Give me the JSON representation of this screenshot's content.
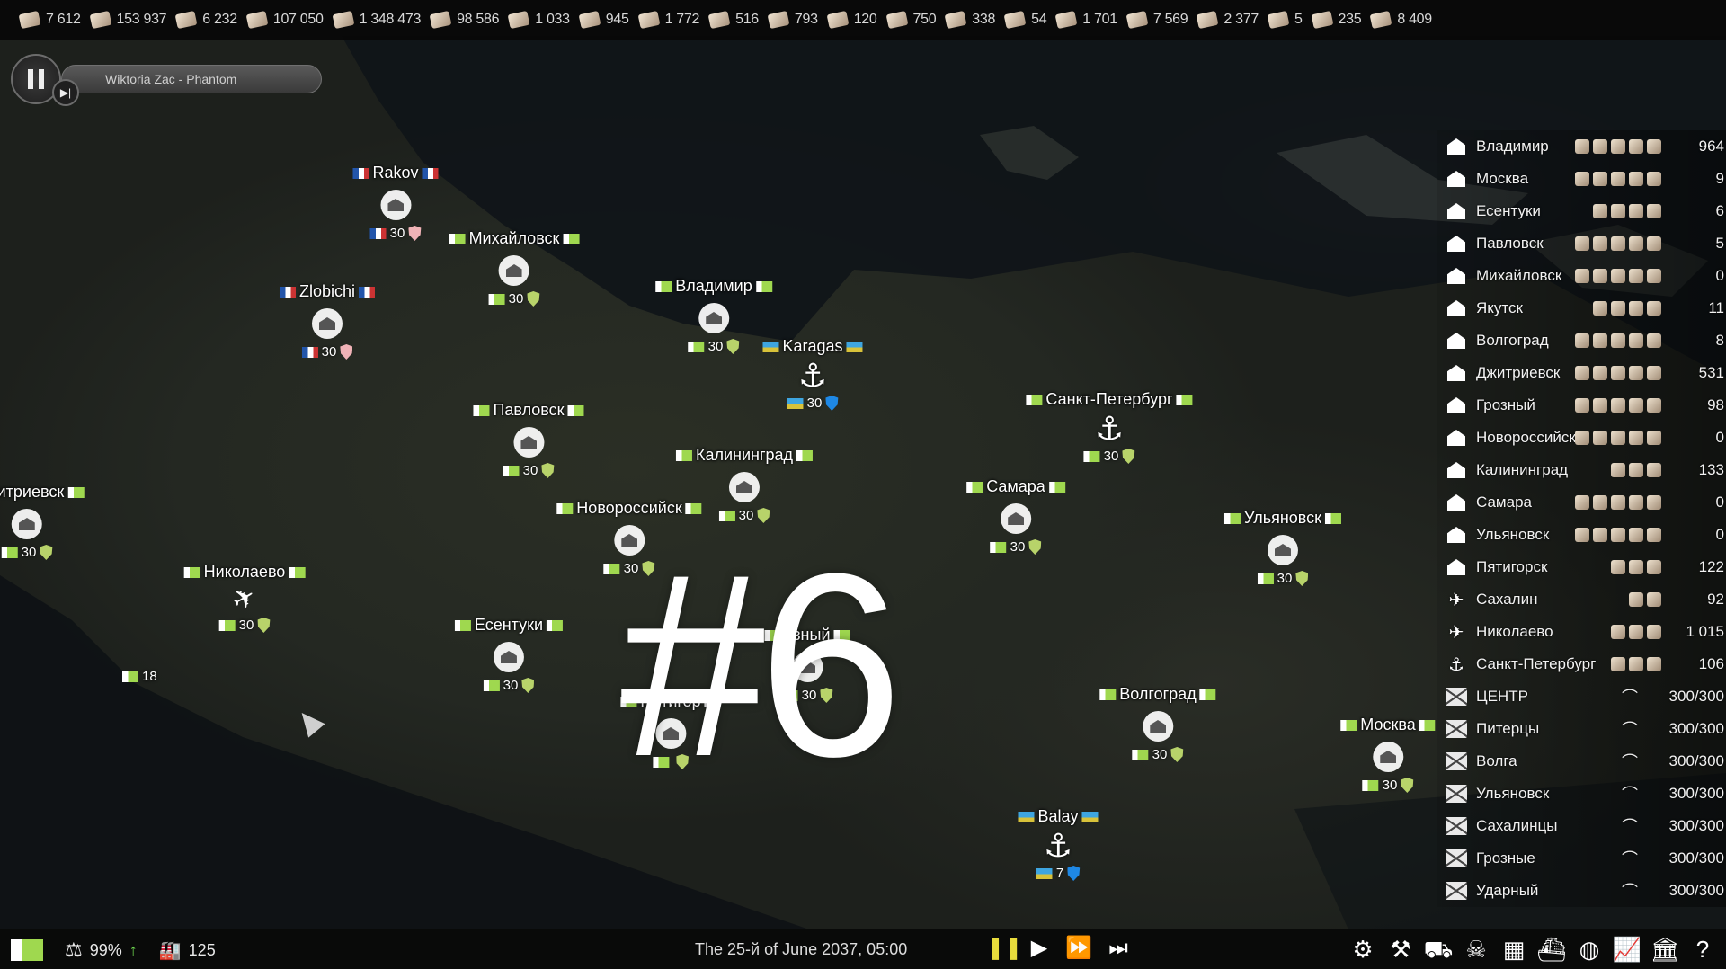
{
  "resources": [
    {
      "icon": "paper-icon",
      "value": "7 612"
    },
    {
      "icon": "bread-icon",
      "value": "153 937"
    },
    {
      "icon": "pen-icon",
      "value": "6 232"
    },
    {
      "icon": "canned-food-icon",
      "value": "107 050"
    },
    {
      "icon": "lumber-icon",
      "value": "1 348 473"
    },
    {
      "icon": "wheat-icon",
      "value": "98 586"
    },
    {
      "icon": "ore-icon",
      "value": "1 033"
    },
    {
      "icon": "steel-icon",
      "value": "945"
    },
    {
      "icon": "coal-icon",
      "value": "1 772"
    },
    {
      "icon": "metal-icon",
      "value": "516"
    },
    {
      "icon": "stone-icon",
      "value": "793"
    },
    {
      "icon": "log-icon",
      "value": "120"
    },
    {
      "icon": "gravel-icon",
      "value": "750"
    },
    {
      "icon": "gold-icon",
      "value": "338"
    },
    {
      "icon": "wood-icon",
      "value": "54"
    },
    {
      "icon": "crate-icon",
      "value": "1 701"
    },
    {
      "icon": "wool-icon",
      "value": "7 569"
    },
    {
      "icon": "glass-icon",
      "value": "2 377"
    },
    {
      "icon": "bottle-icon",
      "value": "5"
    },
    {
      "icon": "meat-icon",
      "value": "235"
    },
    {
      "icon": "grain-icon",
      "value": "8 409"
    }
  ],
  "player": {
    "track": "Wiktoria Zac - Phantom"
  },
  "cities": [
    {
      "name": "Rakov",
      "flag": "r",
      "kind": "house",
      "level": "30",
      "shield": "pink"
    },
    {
      "name": "Zlobichi",
      "flag": "r",
      "kind": "house",
      "level": "30",
      "shield": "pink"
    },
    {
      "name": "Михайловск",
      "flag": "g",
      "kind": "house",
      "level": "30",
      "shield": "green"
    },
    {
      "name": "Владимир",
      "flag": "g",
      "kind": "house",
      "level": "30",
      "shield": "green"
    },
    {
      "name": "Karagas",
      "flag": "k",
      "kind": "anchor",
      "level": "30",
      "shield": "blue"
    },
    {
      "name": "Павловск",
      "flag": "g",
      "kind": "house",
      "level": "30",
      "shield": "green"
    },
    {
      "name": "Калининград",
      "flag": "g",
      "kind": "house",
      "level": "30",
      "shield": "green"
    },
    {
      "name": "Санкт-Петербург",
      "flag": "g",
      "kind": "anchor",
      "level": "30",
      "shield": "green"
    },
    {
      "name": "Новороссийск",
      "flag": "g",
      "kind": "house",
      "level": "30",
      "shield": "green"
    },
    {
      "name": "Самара",
      "flag": "g",
      "kind": "house",
      "level": "30",
      "shield": "green"
    },
    {
      "name": "Ульяновск",
      "flag": "g",
      "kind": "house",
      "level": "30",
      "shield": "green"
    },
    {
      "name": "китриевск",
      "flag": "g",
      "kind": "house",
      "level": "30",
      "shield": "green"
    },
    {
      "name": "Николаево",
      "flag": "g",
      "kind": "plane",
      "level": "30",
      "shield": "green"
    },
    {
      "name": "Есентуки",
      "flag": "g",
      "kind": "house",
      "level": "30",
      "shield": "green"
    },
    {
      "name": "озный",
      "flag": "g",
      "kind": "house",
      "level": "30",
      "shield": "green"
    },
    {
      "name": "Пятигор",
      "flag": "g",
      "kind": "house",
      "level": "",
      "shield": "green"
    },
    {
      "name": "Волгоград",
      "flag": "g",
      "kind": "house",
      "level": "30",
      "shield": "green"
    },
    {
      "name": "Москва",
      "flag": "g",
      "kind": "house",
      "level": "30",
      "shield": "green"
    },
    {
      "name": "Balay",
      "flag": "k",
      "kind": "anchor",
      "level": "7",
      "shield": "blue"
    }
  ],
  "map_labels": {
    "small_level": "18"
  },
  "episode": "#6",
  "panel": [
    {
      "icon": "factory-icon",
      "name": "Владимир",
      "goods": 5,
      "value": "964"
    },
    {
      "icon": "factory-icon",
      "name": "Москва",
      "goods": 5,
      "value": "9"
    },
    {
      "icon": "factory-icon",
      "name": "Есентуки",
      "goods": 4,
      "value": "6"
    },
    {
      "icon": "warehouse-icon",
      "name": "Павловск",
      "goods": 5,
      "value": "5"
    },
    {
      "icon": "warehouse-icon",
      "name": "Михайловск",
      "goods": 5,
      "value": "0"
    },
    {
      "icon": "warehouse-icon",
      "name": "Якутск",
      "goods": 4,
      "value": "11"
    },
    {
      "icon": "warehouse-icon",
      "name": "Волгоград",
      "goods": 5,
      "value": "8"
    },
    {
      "icon": "warehouse-icon",
      "name": "Джитриевск",
      "goods": 5,
      "value": "531"
    },
    {
      "icon": "warehouse-icon",
      "name": "Грозный",
      "goods": 5,
      "value": "98"
    },
    {
      "icon": "farm-icon",
      "name": "Новороссийск",
      "goods": 5,
      "value": "0"
    },
    {
      "icon": "farm-icon",
      "name": "Калининград",
      "goods": 3,
      "value": "133"
    },
    {
      "icon": "farm-icon",
      "name": "Самара",
      "goods": 5,
      "value": "0"
    },
    {
      "icon": "farm-icon",
      "name": "Ульяновск",
      "goods": 5,
      "value": "0"
    },
    {
      "icon": "farm-icon",
      "name": "Пятигорск",
      "goods": 3,
      "value": "122"
    },
    {
      "icon": "airport-icon",
      "name": "Сахалин",
      "goods": 2,
      "value": "92"
    },
    {
      "icon": "airport-icon",
      "name": "Николаево",
      "goods": 3,
      "value": "1 015"
    },
    {
      "icon": "anchor-icon",
      "name": "Санкт-Петербург",
      "goods": 3,
      "value": "106"
    }
  ],
  "companies": [
    {
      "name": "ЦЕНТР",
      "value": "300/300"
    },
    {
      "name": "Питерцы",
      "value": "300/300"
    },
    {
      "name": "Волга",
      "value": "300/300"
    },
    {
      "name": "Ульяновск",
      "value": "300/300"
    },
    {
      "name": "Сахалинцы",
      "value": "300/300"
    },
    {
      "name": "Грозные",
      "value": "300/300"
    },
    {
      "name": "Ударный",
      "value": "300/300"
    }
  ],
  "bottom": {
    "approval": "99%",
    "buildings": "125",
    "date": "The 25-й of June 2037, 05:00"
  },
  "colors": {
    "accent_green": "#9fd84f",
    "pause_yellow": "#e8dc3c",
    "shield_green": "#b8d36a",
    "shield_blue": "#1e88e5"
  }
}
